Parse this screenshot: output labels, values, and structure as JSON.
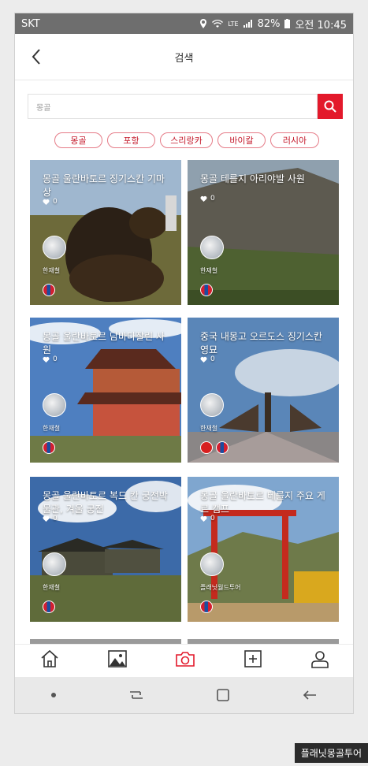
{
  "statusbar": {
    "carrier": "SKT",
    "lte": "LTE",
    "battery": "82%",
    "time": "오전 10:45"
  },
  "header": {
    "title": "검색"
  },
  "search": {
    "value": "몽골"
  },
  "chips": [
    "몽골",
    "포항",
    "스리랑카",
    "바이칼",
    "러시아"
  ],
  "cards": [
    {
      "title": "몽골 울란바토르 징기스칸 기마상",
      "likes": "0",
      "author": "한재철"
    },
    {
      "title": "몽골 테를지 아리야발 사원",
      "likes": "0",
      "author": "한재철"
    },
    {
      "title": "몽골 울란바토르 담바다잘린 사원",
      "likes": "0",
      "author": "한재철"
    },
    {
      "title": "중국 내몽고 오르도스 징기스칸 영묘",
      "likes": "0",
      "author": "한재철"
    },
    {
      "title": "몽골 울란바토르 복드 칸 궁전박물관, 겨울 궁전",
      "likes": "0",
      "author": "한재철"
    },
    {
      "title": "몽골 울란바토르 테를지 주요 게르 캠프",
      "likes": "0",
      "author": "플래닛월드투어"
    }
  ],
  "bottom_nav": [
    "home-icon",
    "gallery-icon",
    "camera-icon",
    "add-icon",
    "profile-icon"
  ],
  "watermark": "플래닛몽골투어",
  "colors": {
    "accent": "#e3192b"
  }
}
